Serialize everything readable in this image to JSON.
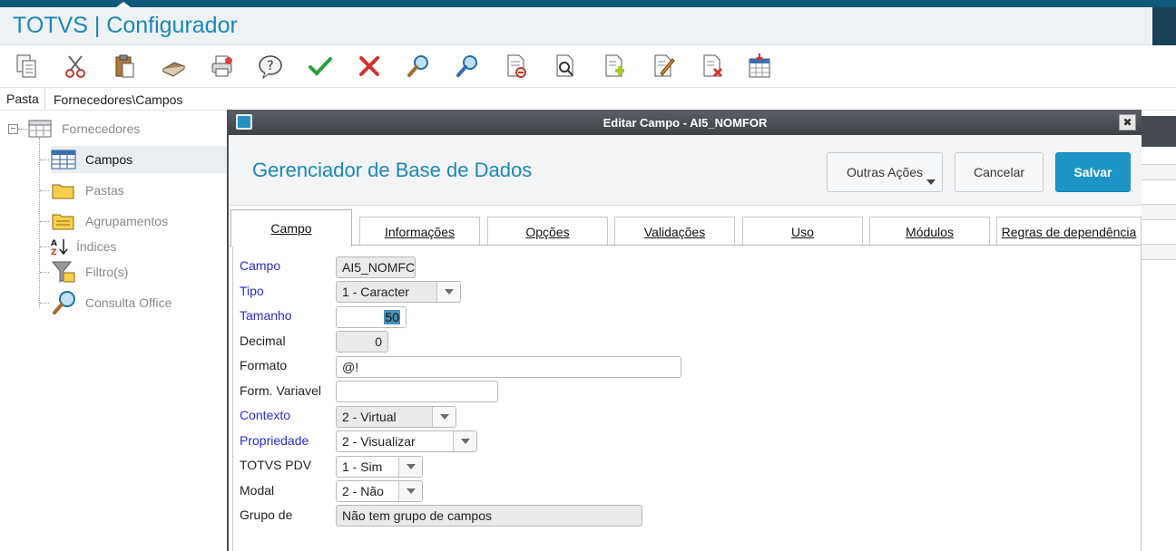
{
  "app": {
    "title": "TOTVS | Configurador"
  },
  "toolbar": {
    "icons": [
      "copy-icon",
      "cut-icon",
      "paste-icon",
      "book-icon",
      "print-icon",
      "help-icon",
      "check-icon",
      "delete-icon",
      "search-icon",
      "search-next-icon",
      "document-remove-icon",
      "document-find-icon",
      "document-add-icon",
      "document-edit-icon",
      "document-delete-icon",
      "table-insert-icon"
    ]
  },
  "pasta": {
    "label": "Pasta",
    "path": "Fornecedores\\Campos"
  },
  "tree": {
    "root": "Fornecedores",
    "items": [
      "Campos",
      "Pastas",
      "Agrupamentos",
      "Índices",
      "Filtro(s)",
      "Consulta Office"
    ]
  },
  "dialog": {
    "title": "Editar Campo - AI5_NOMFOR",
    "header": "Gerenciador de Base de Dados",
    "buttons": {
      "other": "Outras Ações",
      "cancel": "Cancelar",
      "save": "Salvar"
    },
    "tabs": [
      "Campo",
      "Informações",
      "Opções",
      "Validações",
      "Uso",
      "Módulos",
      "Regras de dependência"
    ],
    "fields": {
      "campo": {
        "label": "Campo",
        "value": "AI5_NOMFC"
      },
      "tipo": {
        "label": "Tipo",
        "value": "1 - Caracter"
      },
      "tamanho": {
        "label": "Tamanho",
        "value": "50"
      },
      "decimal": {
        "label": "Decimal",
        "value": "0"
      },
      "formato": {
        "label": "Formato",
        "value": "@!"
      },
      "form_variavel": {
        "label": "Form. Variavel",
        "value": ""
      },
      "contexto": {
        "label": "Contexto",
        "value": "2 - Virtual"
      },
      "propriedade": {
        "label": "Propriedade",
        "value": "2 - Visualizar"
      },
      "totvs_pdv": {
        "label": "TOTVS PDV",
        "value": "1 - Sim"
      },
      "modal": {
        "label": "Modal",
        "value": "2 - Não"
      },
      "grupo_de": {
        "label": "Grupo de",
        "value": "Não tem grupo de campos"
      }
    }
  },
  "colors": {
    "accent": "#1b87b8",
    "save_button": "#1e95c6",
    "required_label": "#2a2ad0"
  }
}
